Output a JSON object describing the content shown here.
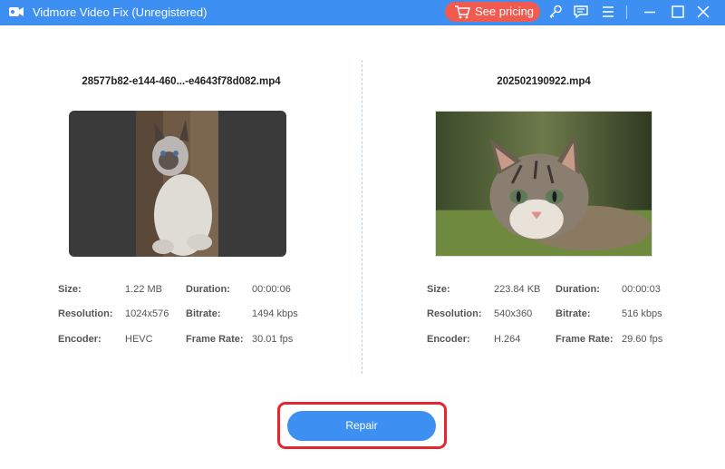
{
  "window": {
    "title": "Vidmore Video Fix (Unregistered)",
    "pricing_label": "See pricing",
    "brand_color": "#3d8ff2",
    "pricing_color": "#f05a4f",
    "icons": [
      "key-icon",
      "feedback-icon",
      "menu-icon",
      "minimize-icon",
      "maximize-icon",
      "close-icon"
    ]
  },
  "left": {
    "filename": "28577b82-e144-460...-e4643f78d082.mp4",
    "info": {
      "size_label": "Size:",
      "size": "1.22 MB",
      "duration_label": "Duration:",
      "duration": "00:00:06",
      "resolution_label": "Resolution:",
      "resolution": "1024x576",
      "bitrate_label": "Bitrate:",
      "bitrate": "1494 kbps",
      "encoder_label": "Encoder:",
      "encoder": "HEVC",
      "framerate_label": "Frame Rate:",
      "framerate": "30.01 fps"
    }
  },
  "right": {
    "filename": "202502190922.mp4",
    "info": {
      "size_label": "Size:",
      "size": "223.84 KB",
      "duration_label": "Duration:",
      "duration": "00:00:03",
      "resolution_label": "Resolution:",
      "resolution": "540x360",
      "bitrate_label": "Bitrate:",
      "bitrate": "516 kbps",
      "encoder_label": "Encoder:",
      "encoder": "H.264",
      "framerate_label": "Frame Rate:",
      "framerate": "29.60 fps"
    }
  },
  "repair_label": "Repair",
  "highlight_color": "#e4262f"
}
